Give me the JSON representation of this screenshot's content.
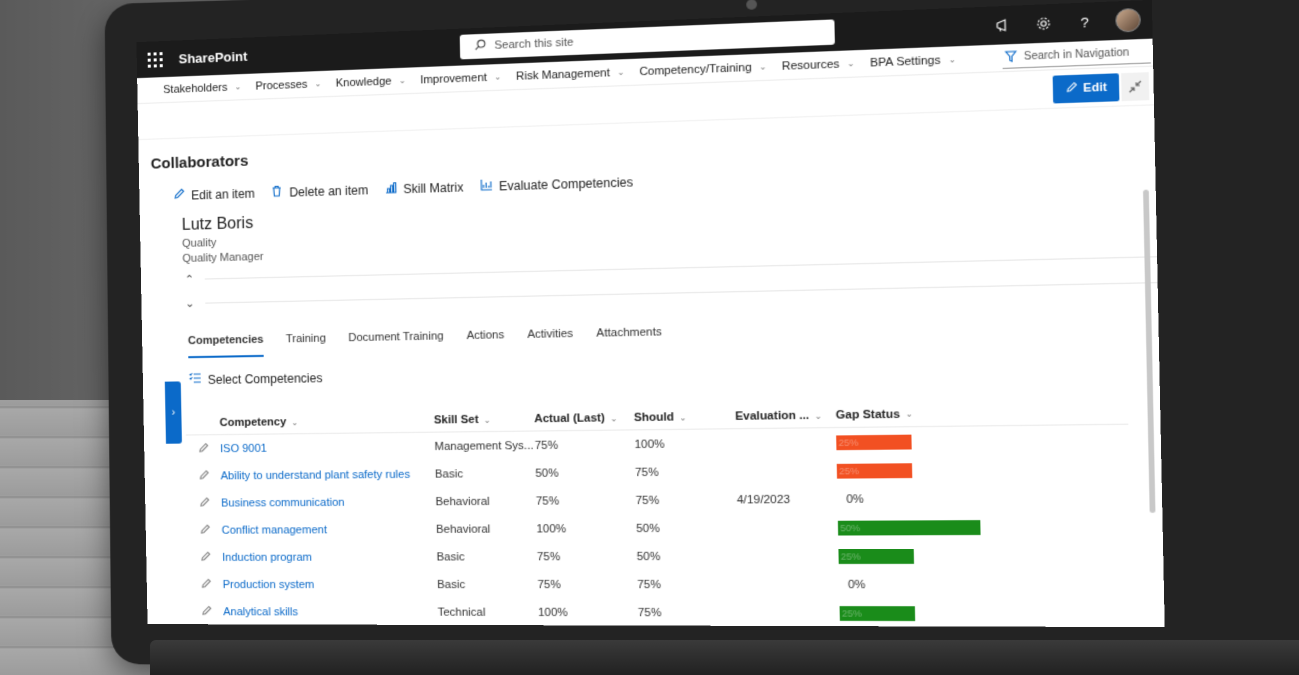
{
  "topbar": {
    "app_name": "SharePoint",
    "search_placeholder": "Search this site"
  },
  "nav": {
    "items": [
      {
        "label": "Stakeholders"
      },
      {
        "label": "Processes"
      },
      {
        "label": "Knowledge"
      },
      {
        "label": "Improvement"
      },
      {
        "label": "Risk Management"
      },
      {
        "label": "Competency/Training"
      },
      {
        "label": "Resources"
      },
      {
        "label": "BPA Settings"
      }
    ],
    "search_label": "Search in Navigation"
  },
  "toolbar": {
    "edit_label": "Edit"
  },
  "page": {
    "title": "Collaborators"
  },
  "actions": {
    "edit_item": "Edit an item",
    "delete_item": "Delete an item",
    "skill_matrix": "Skill Matrix",
    "evaluate": "Evaluate Competencies"
  },
  "person": {
    "name": "Lutz Boris",
    "department": "Quality",
    "role": "Quality Manager"
  },
  "tabs": [
    {
      "label": "Competencies"
    },
    {
      "label": "Training"
    },
    {
      "label": "Document Training"
    },
    {
      "label": "Actions"
    },
    {
      "label": "Activities"
    },
    {
      "label": "Attachments"
    }
  ],
  "select_competencies_label": "Select Competencies",
  "table": {
    "headers": {
      "competency": "Competency",
      "skill_set": "Skill Set",
      "actual": "Actual (Last)",
      "should": "Should",
      "evaluation": "Evaluation ...",
      "gap_status": "Gap Status"
    },
    "rows": [
      {
        "competency": "ISO 9001",
        "skill_set": "Management Sys...",
        "actual": "75%",
        "should": "100%",
        "evaluation": "",
        "gap": "25%",
        "gap_color": "#f25022",
        "gap_fraction": 0.25
      },
      {
        "competency": "Ability to understand plant safety rules",
        "skill_set": "Basic",
        "actual": "50%",
        "should": "75%",
        "evaluation": "",
        "gap": "25%",
        "gap_color": "#f25022",
        "gap_fraction": 0.25
      },
      {
        "competency": "Business communication",
        "skill_set": "Behavioral",
        "actual": "75%",
        "should": "75%",
        "evaluation": "4/19/2023",
        "gap": "0%",
        "gap_color": "",
        "gap_fraction": 0
      },
      {
        "competency": "Conflict management",
        "skill_set": "Behavioral",
        "actual": "100%",
        "should": "50%",
        "evaluation": "",
        "gap": "50%",
        "gap_color": "#1a8c1a",
        "gap_fraction": 0.5
      },
      {
        "competency": "Induction program",
        "skill_set": "Basic",
        "actual": "75%",
        "should": "50%",
        "evaluation": "",
        "gap": "25%",
        "gap_color": "#1a8c1a",
        "gap_fraction": 0.25
      },
      {
        "competency": "Production system",
        "skill_set": "Basic",
        "actual": "75%",
        "should": "75%",
        "evaluation": "",
        "gap": "0%",
        "gap_color": "",
        "gap_fraction": 0
      },
      {
        "competency": "Analytical skills",
        "skill_set": "Technical",
        "actual": "100%",
        "should": "75%",
        "evaluation": "",
        "gap": "25%",
        "gap_color": "#1a8c1a",
        "gap_fraction": 0.25
      }
    ]
  },
  "colors": {
    "accent": "#0b6ac9",
    "gap_negative": "#f25022",
    "gap_positive": "#1a8c1a"
  }
}
